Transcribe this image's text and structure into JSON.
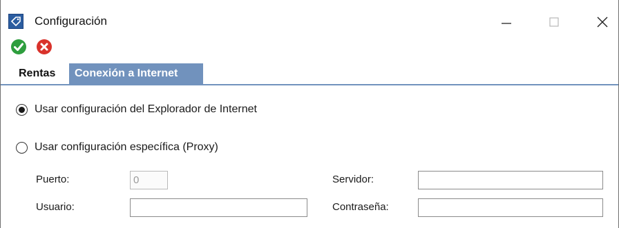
{
  "window": {
    "title": "Configuración",
    "icon": "app-tag-icon",
    "controls": [
      "minimize-icon",
      "maximize-icon",
      "close-icon"
    ]
  },
  "toolbar": {
    "accept": {
      "icon": "check-circle-icon",
      "color": "#2e9e3e"
    },
    "cancel": {
      "icon": "x-circle-icon",
      "color": "#d9322b"
    }
  },
  "tabs": [
    {
      "label": "Rentas",
      "active": false
    },
    {
      "label": "Conexión a Internet",
      "active": true
    }
  ],
  "colors": {
    "tab_accent": "#7192bd",
    "app_icon": "#2b5da0"
  },
  "options": {
    "explorer": {
      "label": "Usar configuración del Explorador de Internet",
      "selected": true
    },
    "proxy": {
      "label": "Usar configuración específica (Proxy)",
      "selected": false
    }
  },
  "fields": {
    "puerto": {
      "label": "Puerto:",
      "value": "0",
      "disabled": true
    },
    "servidor": {
      "label": "Servidor:",
      "value": ""
    },
    "usuario": {
      "label": "Usuario:",
      "value": ""
    },
    "contrasena": {
      "label": "Contraseña:",
      "value": ""
    }
  }
}
